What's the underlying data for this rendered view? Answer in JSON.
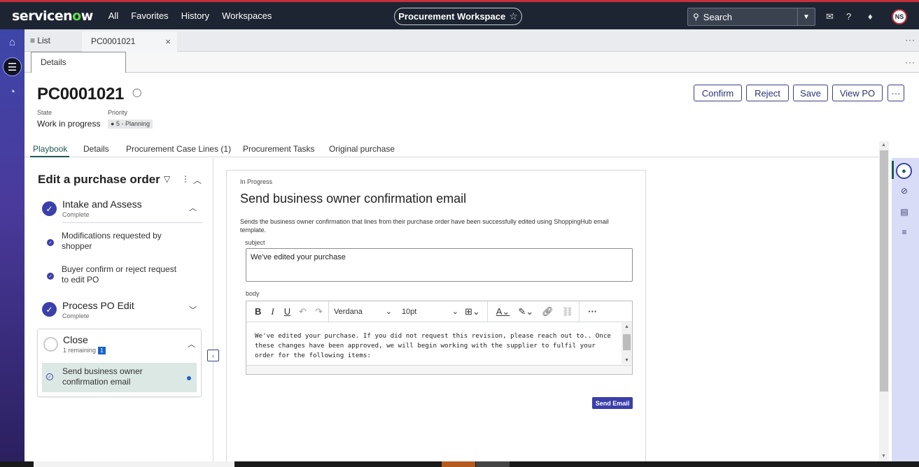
{
  "topbar": {
    "logo": "servicenow",
    "nav": [
      "All",
      "Favorites",
      "History",
      "Workspaces"
    ],
    "workspace": "Procurement Workspace",
    "search_label": "Search",
    "avatar_initials": "NS"
  },
  "tabs": {
    "list_label": "List",
    "record_tab": "PC0001021",
    "details_tab": "Details"
  },
  "record": {
    "number": "PC0001021",
    "state_label": "State",
    "state_value": "Work in progress",
    "priority_label": "Priority",
    "priority_value": "5 - Planning"
  },
  "actions": [
    "Confirm",
    "Reject",
    "Save",
    "View PO"
  ],
  "record_tabs": [
    "Playbook",
    "Details",
    "Procurement Case Lines (1)",
    "Procurement Tasks",
    "Original purchase"
  ],
  "playbook": {
    "title": "Edit a purchase order",
    "stages": [
      {
        "name": "Intake and Assess",
        "status": "Complete",
        "activities": [
          "Modifications requested by shopper",
          "Buyer confirm or reject request to edit PO"
        ]
      },
      {
        "name": "Process PO Edit",
        "status": "Complete"
      },
      {
        "name": "Close",
        "remaining": "1 remaining",
        "remaining_count": "1",
        "activity": "Send business owner confirmation email"
      }
    ]
  },
  "card": {
    "status": "In Progress",
    "title": "Send business owner confirmation email",
    "description": "Sends the business owner confirmation that lines from their purchase order have been successfully edited using ShoppingHub email template.",
    "subject_label": "subject",
    "subject_value": "We've edited your purchase",
    "body_label": "body",
    "font": "Verdana",
    "font_size": "10pt",
    "body_text": "We've edited your purchase. If you did not request this revision, please reach out to.. Once these changes have been approved, we will begin working with the supplier to fulfil your order for the following items:",
    "send_button": "Send Email"
  },
  "colors": {
    "accent": "#3b3faa",
    "topbar": "#1d2532",
    "selected_activity": "#dce8e4"
  }
}
